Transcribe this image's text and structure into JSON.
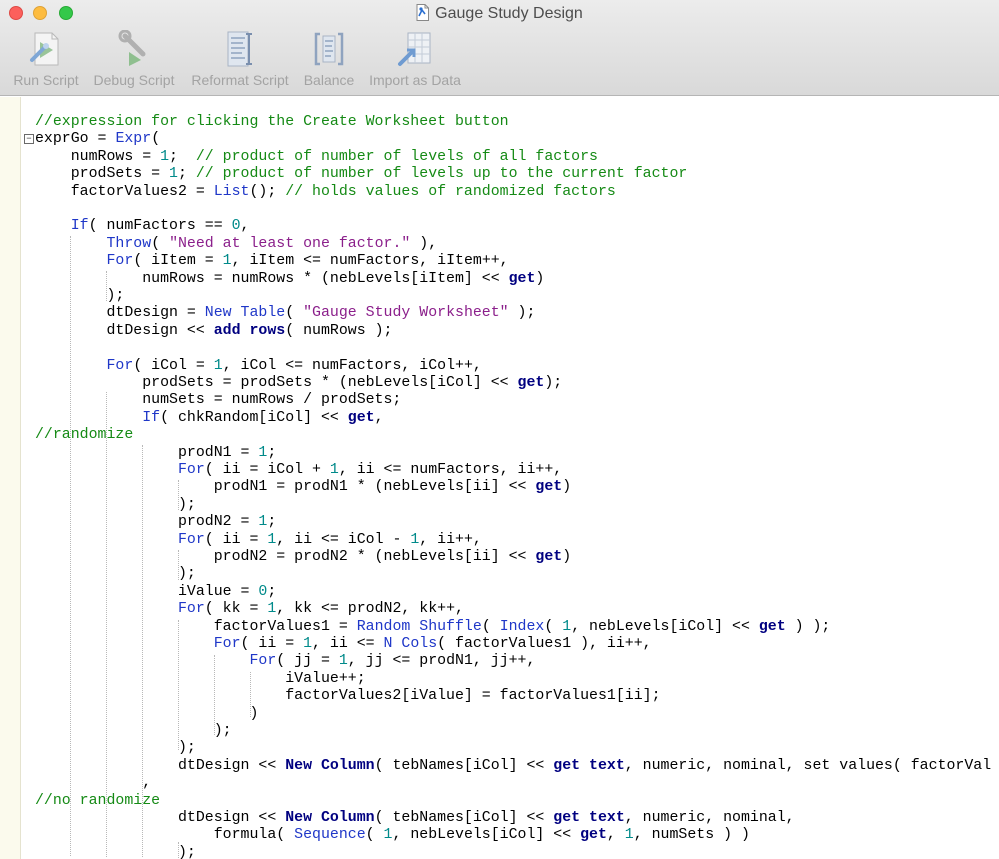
{
  "window": {
    "title": "Gauge Study Design"
  },
  "toolbar": {
    "items": [
      {
        "label": "Run Script",
        "icon": "run-script-icon"
      },
      {
        "label": "Debug Script",
        "icon": "debug-script-icon"
      },
      {
        "label": "Reformat Script",
        "icon": "reformat-script-icon"
      },
      {
        "label": "Balance",
        "icon": "balance-icon"
      },
      {
        "label": "Import as Data",
        "icon": "import-as-data-icon"
      }
    ]
  },
  "colors": {
    "comment": "#158a15",
    "keyword": "#1f37c8",
    "string": "#8b1f8b",
    "number": "#008a8a",
    "message": "#000080",
    "gutter": "#fbfaed"
  },
  "code_lines": [
    [
      {
        "t": "//expression for clicking the Create Worksheet button",
        "c": "c"
      }
    ],
    [
      {
        "t": "exprGo = ",
        "c": "d"
      },
      {
        "t": "Expr",
        "c": "k"
      },
      {
        "t": "(",
        "c": "d"
      }
    ],
    [
      {
        "t": "    numRows = ",
        "c": "d"
      },
      {
        "t": "1",
        "c": "n"
      },
      {
        "t": ";  ",
        "c": "d"
      },
      {
        "t": "// product of number of levels of all factors",
        "c": "c"
      }
    ],
    [
      {
        "t": "    prodSets = ",
        "c": "d"
      },
      {
        "t": "1",
        "c": "n"
      },
      {
        "t": "; ",
        "c": "d"
      },
      {
        "t": "// product of number of levels up to the current factor",
        "c": "c"
      }
    ],
    [
      {
        "t": "    factorValues2 = ",
        "c": "d"
      },
      {
        "t": "List",
        "c": "k"
      },
      {
        "t": "(); ",
        "c": "d"
      },
      {
        "t": "// holds values of randomized factors",
        "c": "c"
      }
    ],
    [
      {
        "t": "",
        "c": "d"
      }
    ],
    [
      {
        "t": "    ",
        "c": "d"
      },
      {
        "t": "If",
        "c": "k"
      },
      {
        "t": "( numFactors == ",
        "c": "d"
      },
      {
        "t": "0",
        "c": "n"
      },
      {
        "t": ",",
        "c": "d"
      }
    ],
    [
      {
        "t": "        ",
        "c": "d"
      },
      {
        "t": "Throw",
        "c": "k"
      },
      {
        "t": "( ",
        "c": "d"
      },
      {
        "t": "\"Need at least one factor.\"",
        "c": "s"
      },
      {
        "t": " ),",
        "c": "d"
      }
    ],
    [
      {
        "t": "        ",
        "c": "d"
      },
      {
        "t": "For",
        "c": "k"
      },
      {
        "t": "( iItem = ",
        "c": "d"
      },
      {
        "t": "1",
        "c": "n"
      },
      {
        "t": ", iItem <= numFactors, iItem++,",
        "c": "d"
      }
    ],
    [
      {
        "t": "            numRows = numRows * (nebLevels[iItem] << ",
        "c": "d"
      },
      {
        "t": "get",
        "c": "b"
      },
      {
        "t": ")",
        "c": "d"
      }
    ],
    [
      {
        "t": "        );",
        "c": "d"
      }
    ],
    [
      {
        "t": "        dtDesign = ",
        "c": "d"
      },
      {
        "t": "New Table",
        "c": "k"
      },
      {
        "t": "( ",
        "c": "d"
      },
      {
        "t": "\"Gauge Study Worksheet\"",
        "c": "s"
      },
      {
        "t": " );",
        "c": "d"
      }
    ],
    [
      {
        "t": "        dtDesign << ",
        "c": "d"
      },
      {
        "t": "add rows",
        "c": "b"
      },
      {
        "t": "( numRows );",
        "c": "d"
      }
    ],
    [
      {
        "t": "",
        "c": "d"
      }
    ],
    [
      {
        "t": "        ",
        "c": "d"
      },
      {
        "t": "For",
        "c": "k"
      },
      {
        "t": "( iCol = ",
        "c": "d"
      },
      {
        "t": "1",
        "c": "n"
      },
      {
        "t": ", iCol <= numFactors, iCol++,",
        "c": "d"
      }
    ],
    [
      {
        "t": "            prodSets = prodSets * (nebLevels[iCol] << ",
        "c": "d"
      },
      {
        "t": "get",
        "c": "b"
      },
      {
        "t": ");",
        "c": "d"
      }
    ],
    [
      {
        "t": "            numSets = numRows / prodSets;",
        "c": "d"
      }
    ],
    [
      {
        "t": "            ",
        "c": "d"
      },
      {
        "t": "If",
        "c": "k"
      },
      {
        "t": "( chkRandom[iCol] << ",
        "c": "d"
      },
      {
        "t": "get",
        "c": "b"
      },
      {
        "t": ",",
        "c": "d"
      }
    ],
    [
      {
        "t": "//randomize",
        "c": "c"
      }
    ],
    [
      {
        "t": "                prodN1 = ",
        "c": "d"
      },
      {
        "t": "1",
        "c": "n"
      },
      {
        "t": ";",
        "c": "d"
      }
    ],
    [
      {
        "t": "                ",
        "c": "d"
      },
      {
        "t": "For",
        "c": "k"
      },
      {
        "t": "( ii = iCol + ",
        "c": "d"
      },
      {
        "t": "1",
        "c": "n"
      },
      {
        "t": ", ii <= numFactors, ii++,",
        "c": "d"
      }
    ],
    [
      {
        "t": "                    prodN1 = prodN1 * (nebLevels[ii] << ",
        "c": "d"
      },
      {
        "t": "get",
        "c": "b"
      },
      {
        "t": ")",
        "c": "d"
      }
    ],
    [
      {
        "t": "                );",
        "c": "d"
      }
    ],
    [
      {
        "t": "                prodN2 = ",
        "c": "d"
      },
      {
        "t": "1",
        "c": "n"
      },
      {
        "t": ";",
        "c": "d"
      }
    ],
    [
      {
        "t": "                ",
        "c": "d"
      },
      {
        "t": "For",
        "c": "k"
      },
      {
        "t": "( ii = ",
        "c": "d"
      },
      {
        "t": "1",
        "c": "n"
      },
      {
        "t": ", ii <= iCol - ",
        "c": "d"
      },
      {
        "t": "1",
        "c": "n"
      },
      {
        "t": ", ii++,",
        "c": "d"
      }
    ],
    [
      {
        "t": "                    prodN2 = prodN2 * (nebLevels[ii] << ",
        "c": "d"
      },
      {
        "t": "get",
        "c": "b"
      },
      {
        "t": ")",
        "c": "d"
      }
    ],
    [
      {
        "t": "                );",
        "c": "d"
      }
    ],
    [
      {
        "t": "                iValue = ",
        "c": "d"
      },
      {
        "t": "0",
        "c": "n"
      },
      {
        "t": ";",
        "c": "d"
      }
    ],
    [
      {
        "t": "                ",
        "c": "d"
      },
      {
        "t": "For",
        "c": "k"
      },
      {
        "t": "( kk = ",
        "c": "d"
      },
      {
        "t": "1",
        "c": "n"
      },
      {
        "t": ", kk <= prodN2, kk++,",
        "c": "d"
      }
    ],
    [
      {
        "t": "                    factorValues1 = ",
        "c": "d"
      },
      {
        "t": "Random Shuffle",
        "c": "k"
      },
      {
        "t": "( ",
        "c": "d"
      },
      {
        "t": "Index",
        "c": "k"
      },
      {
        "t": "( ",
        "c": "d"
      },
      {
        "t": "1",
        "c": "n"
      },
      {
        "t": ", nebLevels[iCol] << ",
        "c": "d"
      },
      {
        "t": "get",
        "c": "b"
      },
      {
        "t": " ) );",
        "c": "d"
      }
    ],
    [
      {
        "t": "                    ",
        "c": "d"
      },
      {
        "t": "For",
        "c": "k"
      },
      {
        "t": "( ii = ",
        "c": "d"
      },
      {
        "t": "1",
        "c": "n"
      },
      {
        "t": ", ii <= ",
        "c": "d"
      },
      {
        "t": "N Cols",
        "c": "k"
      },
      {
        "t": "( factorValues1 ), ii++,",
        "c": "d"
      }
    ],
    [
      {
        "t": "                        ",
        "c": "d"
      },
      {
        "t": "For",
        "c": "k"
      },
      {
        "t": "( jj = ",
        "c": "d"
      },
      {
        "t": "1",
        "c": "n"
      },
      {
        "t": ", jj <= prodN1, jj++,",
        "c": "d"
      }
    ],
    [
      {
        "t": "                            iValue++;",
        "c": "d"
      }
    ],
    [
      {
        "t": "                            factorValues2[iValue] = factorValues1[ii];",
        "c": "d"
      }
    ],
    [
      {
        "t": "                        )",
        "c": "d"
      }
    ],
    [
      {
        "t": "                    );",
        "c": "d"
      }
    ],
    [
      {
        "t": "                );",
        "c": "d"
      }
    ],
    [
      {
        "t": "                dtDesign << ",
        "c": "d"
      },
      {
        "t": "New Column",
        "c": "b"
      },
      {
        "t": "( tebNames[iCol] << ",
        "c": "d"
      },
      {
        "t": "get text",
        "c": "b"
      },
      {
        "t": ", numeric, nominal, set values( factorVal",
        "c": "d"
      }
    ],
    [
      {
        "t": "            ,",
        "c": "d"
      }
    ],
    [
      {
        "t": "//no randomize",
        "c": "c"
      }
    ],
    [
      {
        "t": "                dtDesign << ",
        "c": "d"
      },
      {
        "t": "New Column",
        "c": "b"
      },
      {
        "t": "( tebNames[iCol] << ",
        "c": "d"
      },
      {
        "t": "get text",
        "c": "b"
      },
      {
        "t": ", numeric, nominal,",
        "c": "d"
      }
    ],
    [
      {
        "t": "                    formula( ",
        "c": "d"
      },
      {
        "t": "Sequence",
        "c": "k"
      },
      {
        "t": "( ",
        "c": "d"
      },
      {
        "t": "1",
        "c": "n"
      },
      {
        "t": ", nebLevels[iCol] << ",
        "c": "d"
      },
      {
        "t": "get",
        "c": "b"
      },
      {
        "t": ", ",
        "c": "d"
      },
      {
        "t": "1",
        "c": "n"
      },
      {
        "t": ", numSets ) )",
        "c": "d"
      }
    ],
    [
      {
        "t": "                );",
        "c": "d"
      }
    ]
  ]
}
